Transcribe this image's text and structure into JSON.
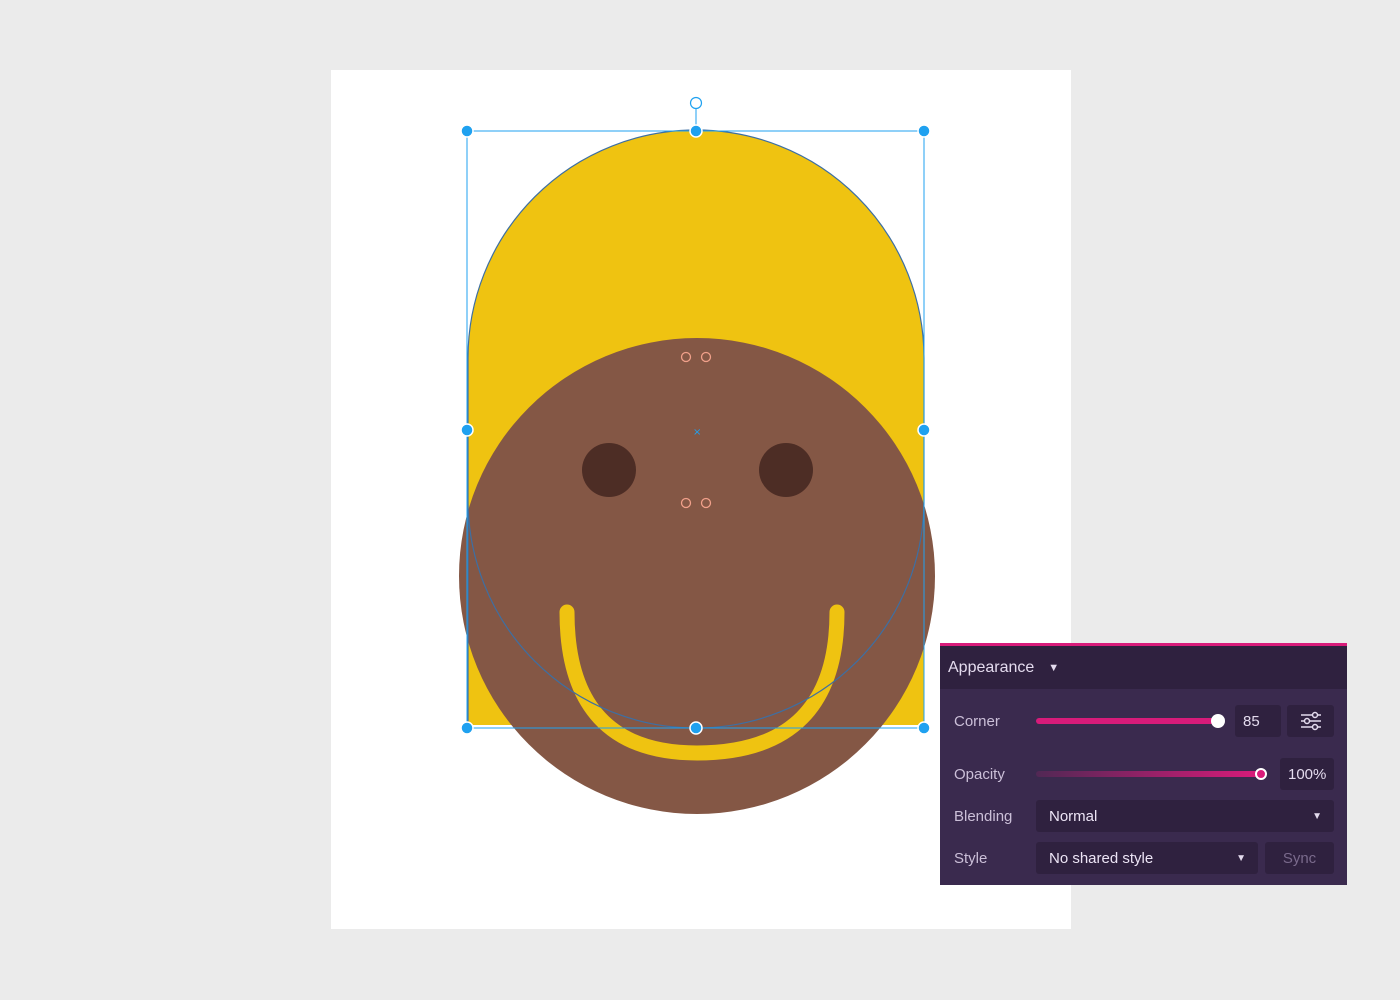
{
  "panel": {
    "title": "Appearance",
    "caret_icon": "caret-down-icon",
    "corner": {
      "label": "Corner",
      "value": "85",
      "slider_level": 0.94,
      "settings_icon": "sliders-icon"
    },
    "opacity": {
      "label": "Opacity",
      "value": "100%",
      "slider_level": 1.0
    },
    "blending": {
      "label": "Blending",
      "value": "Normal"
    },
    "style": {
      "label": "Style",
      "value": "No shared style",
      "sync_label": "Sync"
    }
  },
  "colors": {
    "background": "#ebebeb",
    "artboard": "#ffffff",
    "hair": "#efc311",
    "face": "#845745",
    "eyes": "#4d2d25",
    "smile": "#efc311",
    "selection": "#1fa1f0",
    "anchor": "#e8714f",
    "panel_bg": "#3a2a4e",
    "panel_accent": "#d81b7a"
  }
}
